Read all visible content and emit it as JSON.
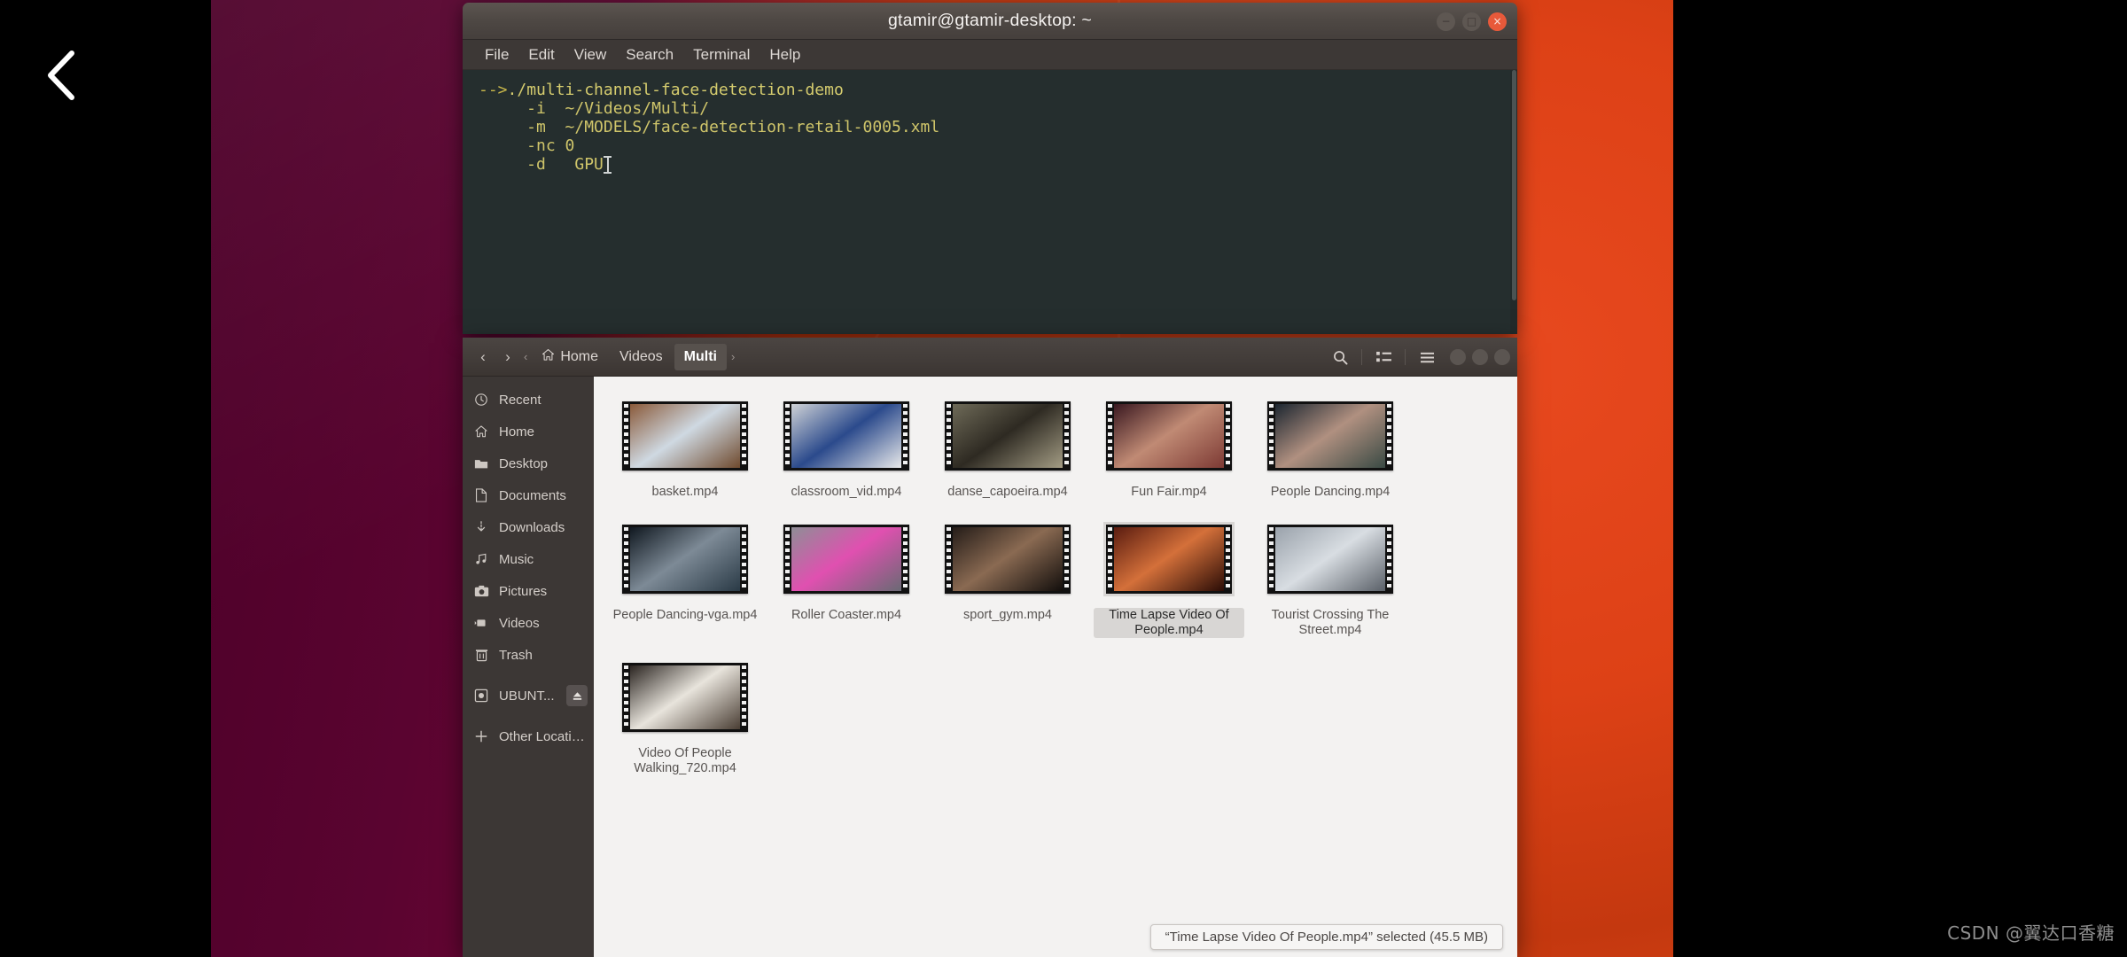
{
  "desktop": {
    "nav_prev_icon": "chevron-left-icon",
    "wallpaper_colors": {
      "left": "#4d0029",
      "right": "#e14a18",
      "letterbox": "#000000"
    }
  },
  "terminal": {
    "title": "gtamir@gtamir-desktop: ~",
    "menu": [
      "File",
      "Edit",
      "View",
      "Search",
      "Terminal",
      "Help"
    ],
    "window_controls": {
      "minimize": "−",
      "maximize": "□",
      "close": "×"
    },
    "lines": [
      {
        "prompt": "-->",
        "text": "./multi-channel-face-detection-demo"
      },
      {
        "prompt": "",
        "text": "     -i  ~/Videos/Multi/"
      },
      {
        "prompt": "",
        "text": "     -m  ~/MODELS/face-detection-retail-0005.xml"
      },
      {
        "prompt": "",
        "text": "     -nc 0"
      },
      {
        "prompt": "",
        "text": "     -d   GPU"
      }
    ]
  },
  "files": {
    "nav": {
      "back": "‹",
      "forward": "›",
      "crumb_prev": "‹",
      "crumb_next": "›"
    },
    "breadcrumbs": [
      {
        "label": "Home",
        "icon": "home-icon",
        "active": false
      },
      {
        "label": "Videos",
        "icon": "",
        "active": false
      },
      {
        "label": "Multi",
        "icon": "",
        "active": true
      }
    ],
    "toolbar": [
      {
        "name": "search-icon",
        "label": "Search"
      },
      {
        "name": "grid-view-icon",
        "label": "Grid view"
      },
      {
        "name": "hamburger-menu-icon",
        "label": "Menu"
      }
    ],
    "window_controls": {
      "minimize": "−",
      "maximize": "□",
      "close": "×"
    },
    "sidebar": [
      {
        "label": "Recent",
        "icon": "clock-icon"
      },
      {
        "label": "Home",
        "icon": "home-icon"
      },
      {
        "label": "Desktop",
        "icon": "folder-icon"
      },
      {
        "label": "Documents",
        "icon": "document-icon"
      },
      {
        "label": "Downloads",
        "icon": "download-icon"
      },
      {
        "label": "Music",
        "icon": "music-note-icon"
      },
      {
        "label": "Pictures",
        "icon": "camera-icon"
      },
      {
        "label": "Videos",
        "icon": "video-camera-icon"
      },
      {
        "label": "Trash",
        "icon": "trash-icon"
      },
      {
        "label": "UBUNT...",
        "icon": "disc-drive-icon",
        "eject": true
      },
      {
        "label": "Other Locations",
        "icon": "plus-icon"
      }
    ],
    "items": [
      {
        "name": "basket.mp4",
        "selected": false,
        "c1": "#8a5a3a",
        "c2": "#cfd9e2",
        "c3": "#6f4a2e"
      },
      {
        "name": "classroom_vid.mp4",
        "selected": false,
        "c1": "#cfd2d6",
        "c2": "#2b4a8c",
        "c3": "#e8e9ea"
      },
      {
        "name": "danse_capoeira.mp4",
        "selected": false,
        "c1": "#6e6a58",
        "c2": "#2e2a22",
        "c3": "#a39c84"
      },
      {
        "name": "Fun Fair.mp4",
        "selected": false,
        "c1": "#3a1820",
        "c2": "#c08a74",
        "c3": "#7d3a34"
      },
      {
        "name": "People Dancing.mp4",
        "selected": false,
        "c1": "#1c2630",
        "c2": "#b09080",
        "c3": "#3a4a44"
      },
      {
        "name": "People Dancing-vga.mp4",
        "selected": false,
        "c1": "#101820",
        "c2": "#7d8a96",
        "c3": "#2a3a46"
      },
      {
        "name": "Roller Coaster.mp4",
        "selected": false,
        "c1": "#8e8e96",
        "c2": "#e050b0",
        "c3": "#6a6a74"
      },
      {
        "name": "sport_gym.mp4",
        "selected": false,
        "c1": "#241c18",
        "c2": "#8a6a52",
        "c3": "#120e0c"
      },
      {
        "name": "Time Lapse Video Of People.mp4",
        "selected": true,
        "c1": "#5a1c10",
        "c2": "#d4703a",
        "c3": "#2a0c06"
      },
      {
        "name": "Tourist Crossing The Street.mp4",
        "selected": false,
        "c1": "#9aa2ab",
        "c2": "#d8dde2",
        "c3": "#5a6068"
      },
      {
        "name": "Video Of People Walking_720.mp4",
        "selected": false,
        "c1": "#2a2420",
        "c2": "#e8e4dc",
        "c3": "#4a3e34"
      }
    ],
    "status": "“Time Lapse Video Of People.mp4” selected  (45.5 MB)"
  },
  "watermark": "CSDN @翼达口香糖"
}
